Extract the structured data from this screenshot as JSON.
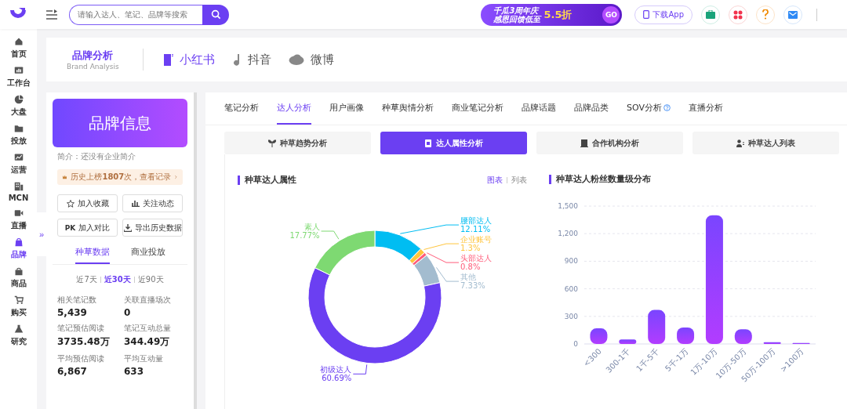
{
  "top_bar": {
    "search": {
      "placeholder": "请输入达人、笔记、品牌等搜索"
    },
    "promo": {
      "line_1": "千瓜3周年庆",
      "line_2": "感恩回馈低至",
      "discount": "5.5折",
      "go": "GO"
    },
    "download_button": "下载App"
  },
  "sidebar": {
    "items": [
      {
        "label": "首页",
        "selected": false
      },
      {
        "label": "工作台",
        "selected": false
      },
      {
        "label": "大盘",
        "selected": false
      },
      {
        "label": "投放",
        "selected": false
      },
      {
        "label": "运营",
        "selected": false
      },
      {
        "label": "MCN",
        "selected": false
      },
      {
        "label": "直播",
        "selected": false
      },
      {
        "label": "品牌",
        "selected": true
      },
      {
        "label": "商品",
        "selected": false
      },
      {
        "label": "购买",
        "selected": false
      },
      {
        "label": "研究",
        "selected": false
      }
    ],
    "collapse_handle": "»"
  },
  "header": {
    "title": "品牌分析",
    "subtitle": "Brand Analysis",
    "platforms": [
      {
        "label": "小红书",
        "selected": true
      },
      {
        "label": "抖音",
        "selected": false
      },
      {
        "label": "微博",
        "selected": false
      }
    ]
  },
  "brand_panel": {
    "banner": "品牌信息",
    "intro": "简介：还没有企业简介",
    "history_notice": "历史上榜**1807**次，查看记录",
    "actions": [
      {
        "label": "加入收藏"
      },
      {
        "label": "关注动态"
      },
      {
        "label": "加入对比",
        "badge": "PK"
      },
      {
        "label": "导出历史数据"
      }
    ],
    "tabs": [
      {
        "label": "种草数据",
        "selected": true
      },
      {
        "label": "商业投放",
        "selected": false
      }
    ],
    "periods": [
      {
        "label": "近7天",
        "selected": false
      },
      {
        "label": "近30天",
        "selected": true
      },
      {
        "label": "近90天",
        "selected": false
      }
    ],
    "stats": [
      {
        "label": "相关笔记数",
        "value": "5,439"
      },
      {
        "label": "关联直播场次",
        "value": "0"
      },
      {
        "label": "笔记预估阅读",
        "value": "3735.48万"
      },
      {
        "label": "笔记互动总量",
        "value": "344.49万"
      },
      {
        "label": "平均预估阅读",
        "value": "6,867"
      },
      {
        "label": "平均互动量",
        "value": "633"
      }
    ]
  },
  "analysis": {
    "tabs": [
      {
        "label": "笔记分析",
        "selected": false,
        "help": false
      },
      {
        "label": "达人分析",
        "selected": true,
        "help": false
      },
      {
        "label": "用户画像",
        "selected": false,
        "help": false
      },
      {
        "label": "种草舆情分析",
        "selected": false,
        "help": false
      },
      {
        "label": "商业笔记分析",
        "selected": false,
        "help": false
      },
      {
        "label": "品牌话题",
        "selected": false,
        "help": false
      },
      {
        "label": "品牌品类",
        "selected": false,
        "help": false
      },
      {
        "label": "SOV分析",
        "selected": false,
        "help": true
      },
      {
        "label": "直播分析",
        "selected": false,
        "help": false
      }
    ],
    "sub_tabs": [
      {
        "label": "种草趋势分析",
        "selected": false
      },
      {
        "label": "达人属性分析",
        "selected": true
      },
      {
        "label": "合作机构分析",
        "selected": false
      },
      {
        "label": "种草达人列表",
        "selected": false
      }
    ],
    "attribute_card": {
      "title": "种草达人属性",
      "views": [
        {
          "label": "图表",
          "selected": true
        },
        {
          "label": "列表",
          "selected": false
        }
      ],
      "chart_data": {
        "type": "donut",
        "categories": [
          "腰部达人",
          "企业账号",
          "头部达人",
          "其他",
          "初级达人",
          "素人"
        ],
        "values": [
          12.11,
          1.3,
          0.8,
          7.33,
          60.69,
          17.77
        ],
        "value_labels": [
          "12.11%",
          "1.3%",
          "0.8%",
          "7.33%",
          "60.69%",
          "17.77%"
        ]
      }
    },
    "fans_card": {
      "title": "种草达人粉丝数量级分布",
      "chart_data": {
        "type": "bar",
        "categories": [
          "<300",
          "300-1千",
          "1千-5千",
          "5千-1万",
          "1万-10万",
          "10万-50万",
          "50万-100万",
          ">100万"
        ],
        "values": [
          170,
          50,
          370,
          180,
          1400,
          160,
          20,
          10
        ],
        "ylim": [
          0,
          1500
        ],
        "grid": true,
        "yticks": [
          0,
          {
            "value": 300,
            "label": "300"
          },
          {
            "value": 600,
            "label": "600"
          },
          {
            "value": 900,
            "label": "900"
          },
          {
            "value": 1200,
            "label": "1,200"
          },
          {
            "value": 1500,
            "label": "1,500"
          }
        ]
      }
    }
  }
}
